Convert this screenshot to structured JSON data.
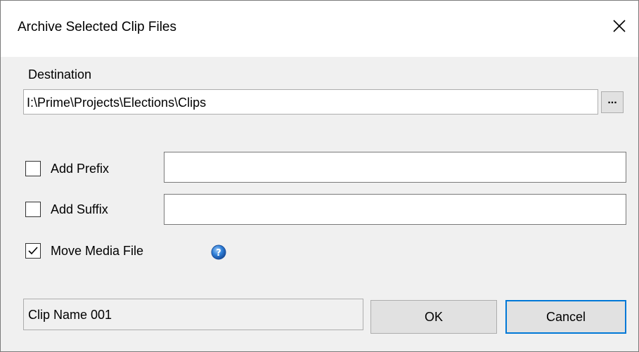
{
  "dialog": {
    "title": "Archive Selected Clip Files",
    "close_icon": "close-icon"
  },
  "destination": {
    "label": "Destination",
    "value": "I:\\Prime\\Projects\\Elections\\Clips",
    "browse_label": "..."
  },
  "prefix": {
    "label": "Add Prefix",
    "checked": false,
    "value": ""
  },
  "suffix": {
    "label": "Add Suffix",
    "checked": false,
    "value": ""
  },
  "move_media": {
    "label": "Move Media File",
    "checked": true,
    "help_icon": "help-icon"
  },
  "footer": {
    "clip_name": "Clip Name 001",
    "ok_label": "OK",
    "cancel_label": "Cancel"
  },
  "colors": {
    "accent": "#0078d7",
    "background": "#f0f0f0",
    "help_icon": "#2f7fd8"
  }
}
